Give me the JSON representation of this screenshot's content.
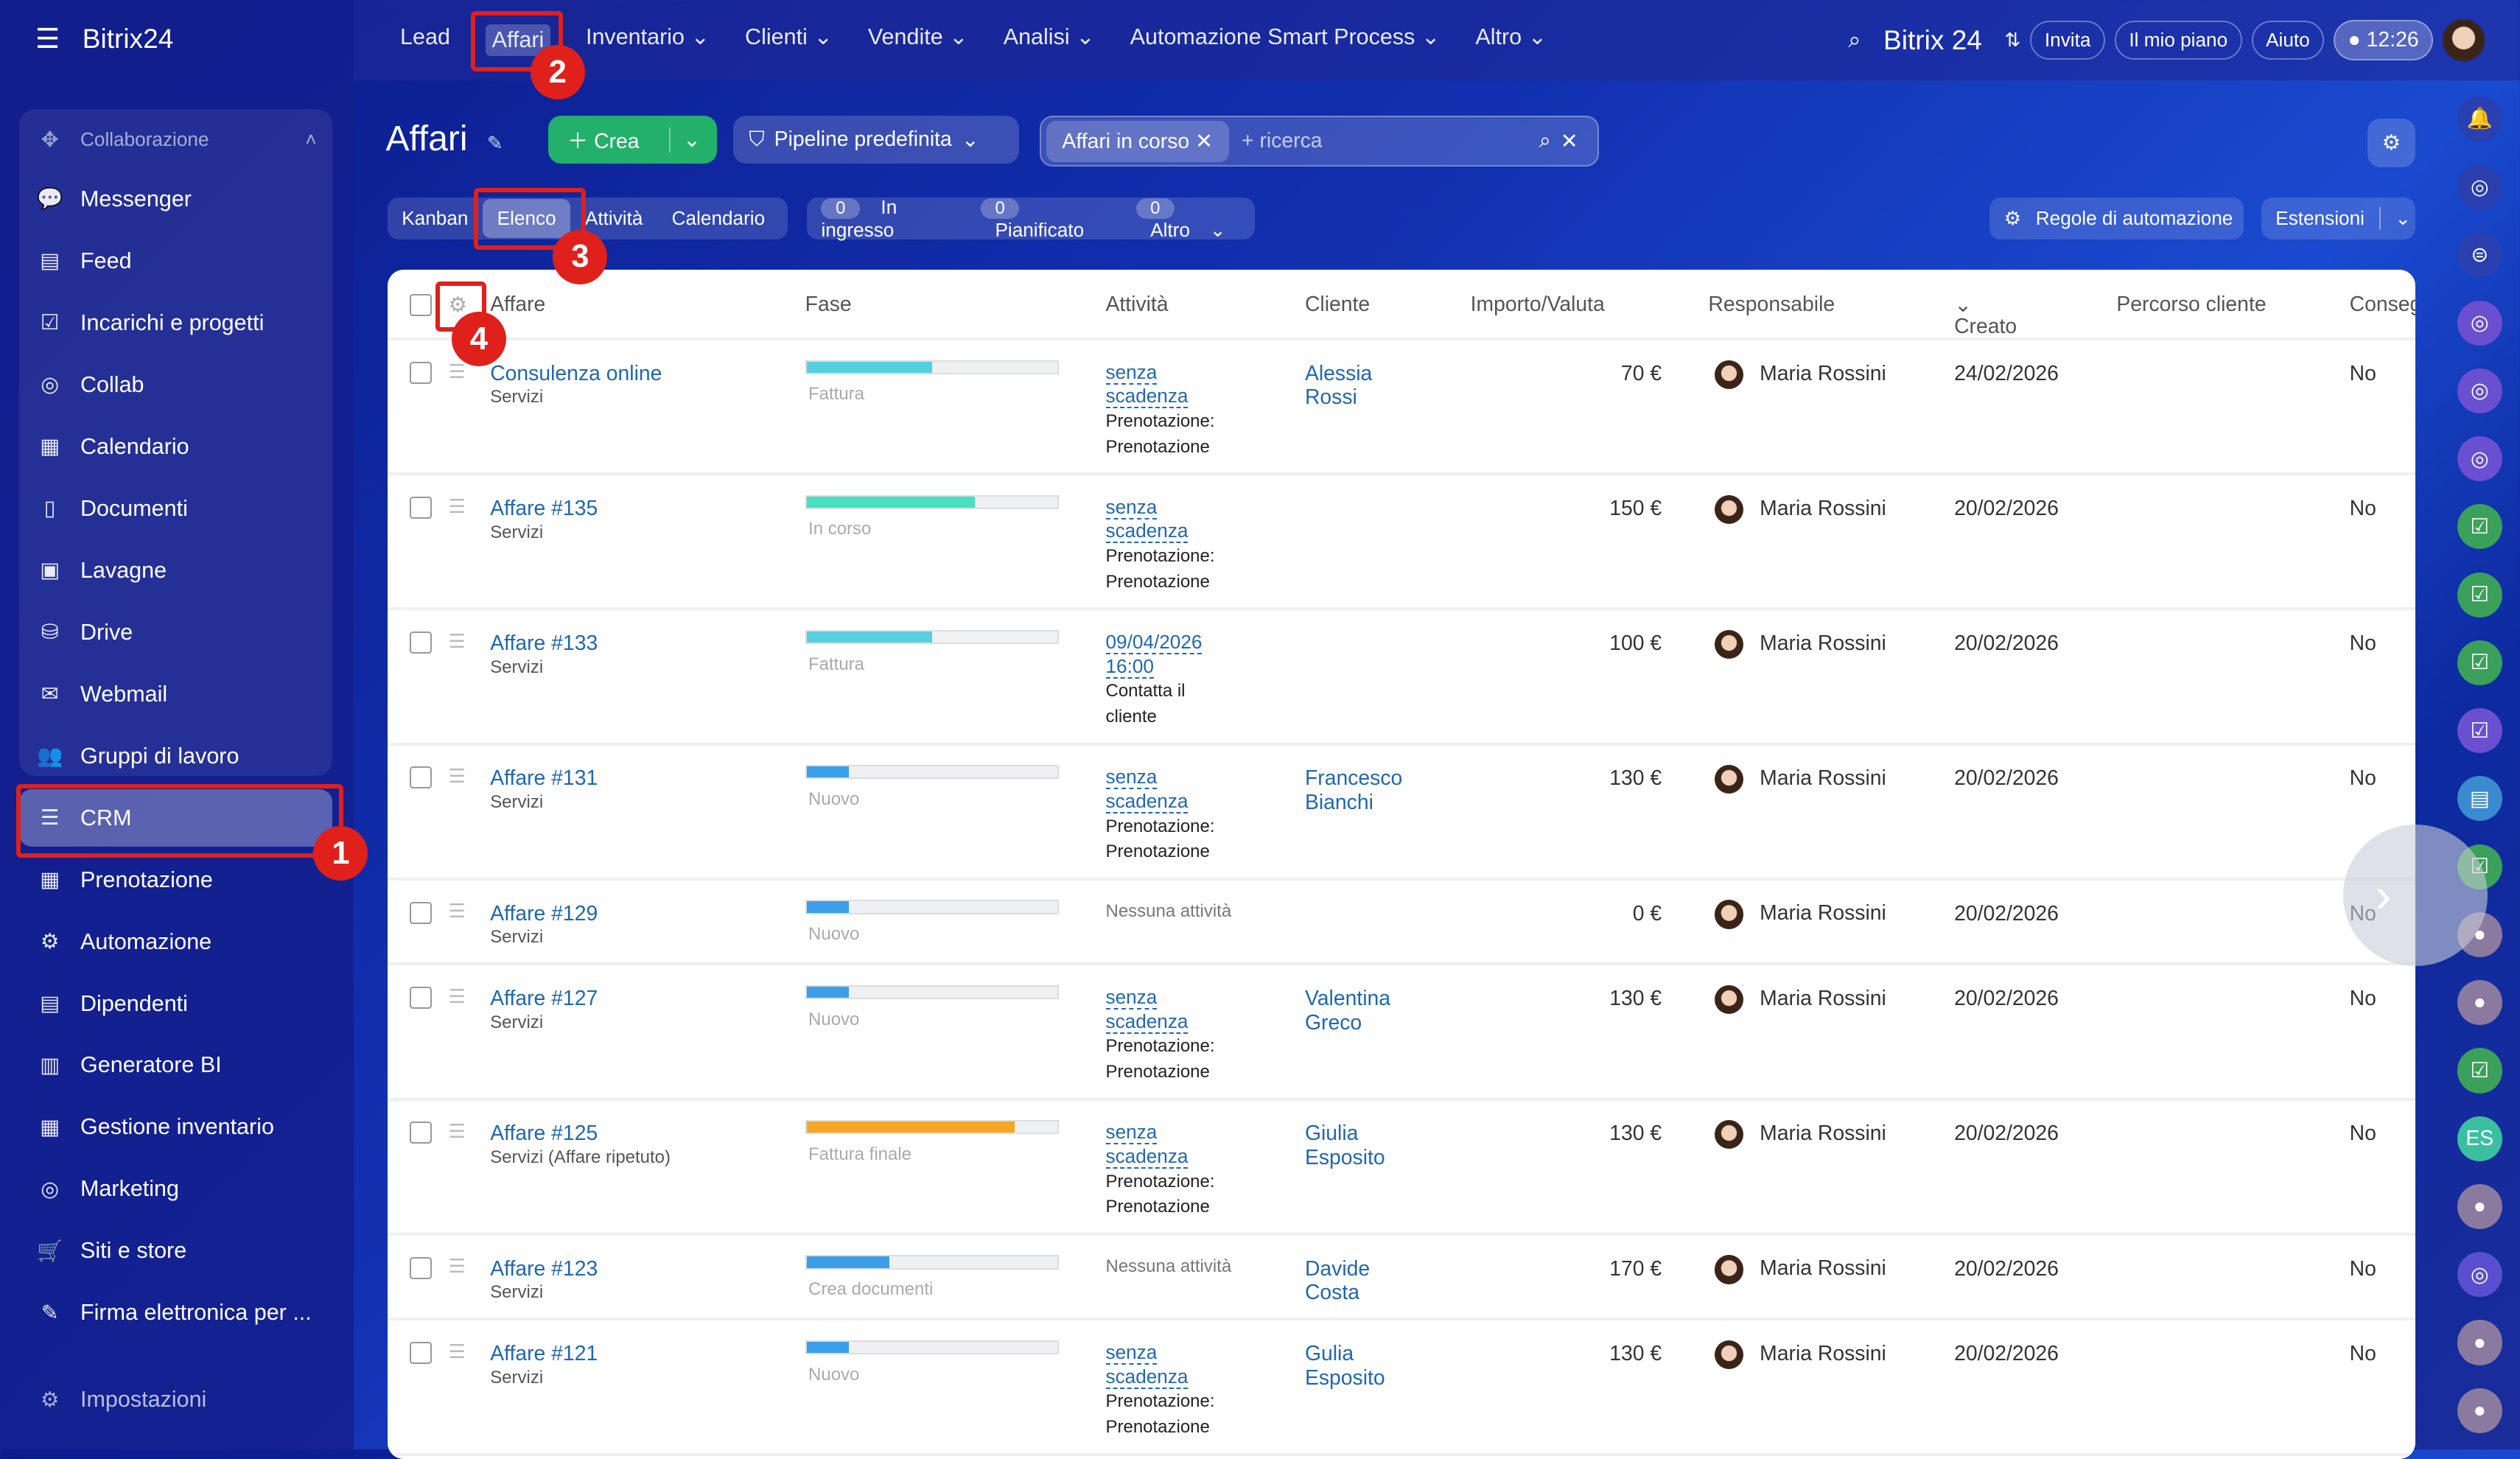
{
  "app": {
    "logo": "Bitrix24",
    "logo_right": "Bitrix 24",
    "time": "12:26"
  },
  "topnav": {
    "items": [
      "Lead",
      "Affari",
      "Inventario",
      "Clienti",
      "Vendite",
      "Analisi",
      "Automazione Smart Process",
      "Altro"
    ],
    "invite": "Invita",
    "plan": "Il mio piano",
    "help": "Aiuto"
  },
  "sidebar": {
    "group": "Collaborazione",
    "items": [
      "Messenger",
      "Feed",
      "Incarichi e progetti",
      "Collab",
      "Calendario",
      "Documenti",
      "Lavagne",
      "Drive",
      "Webmail",
      "Gruppi di lavoro",
      "CRM",
      "Prenotazione",
      "Automazione",
      "Dipendenti",
      "Generatore BI",
      "Gestione inventario",
      "Marketing",
      "Siti e store",
      "Firma elettronica per ..."
    ],
    "settings": "Impostazioni"
  },
  "page": {
    "title": "Affari",
    "create": "Crea",
    "pipeline": "Pipeline predefinita",
    "filter_tag": "Affari in corso",
    "search_placeholder": "+ ricerca"
  },
  "views": {
    "items": [
      "Kanban",
      "Elenco",
      "Attività",
      "Calendario"
    ],
    "counters": [
      {
        "n": "0",
        "label": "In ingresso"
      },
      {
        "n": "0",
        "label": "Pianificato"
      },
      {
        "n": "0",
        "label": "Altro"
      }
    ],
    "automation": "Regole di automazione",
    "extensions": "Estensioni"
  },
  "table": {
    "columns": [
      "Affare",
      "Fase",
      "Attività",
      "Cliente",
      "Importo/Valuta",
      "Responsabile",
      "Creato",
      "Percorso cliente",
      "Conseg"
    ],
    "rows": [
      {
        "name": "Consulenza online",
        "sub": "Servizi",
        "phase": "Fattura",
        "progress": 0.5,
        "color": "#55d0e0",
        "act1": "senza",
        "act2": "scadenza",
        "act3": "Prenotazione:",
        "act4": "Prenotazione",
        "client1": "Alessia",
        "client2": "Rossi",
        "amount": "70 €",
        "resp": "Maria Rossini",
        "created": "24/02/2026",
        "cons": "No"
      },
      {
        "name": "Affare #135",
        "sub": "Servizi",
        "phase": "In corso",
        "progress": 0.67,
        "color": "#47e0c0",
        "act1": "senza",
        "act2": "scadenza",
        "act3": "Prenotazione:",
        "act4": "Prenotazione",
        "client1": "",
        "client2": "",
        "amount": "150 €",
        "resp": "Maria Rossini",
        "created": "20/02/2026",
        "cons": "No"
      },
      {
        "name": "Affare #133",
        "sub": "Servizi",
        "phase": "Fattura",
        "progress": 0.5,
        "color": "#55d0e0",
        "act1": "09/04/2026",
        "act2": "16:00",
        "act3": "Contatta il",
        "act4": "cliente",
        "client1": "",
        "client2": "",
        "amount": "100 €",
        "resp": "Maria Rossini",
        "created": "20/02/2026",
        "cons": "No"
      },
      {
        "name": "Affare #131",
        "sub": "Servizi",
        "phase": "Nuovo",
        "progress": 0.17,
        "color": "#3b9ee8",
        "act1": "senza",
        "act2": "scadenza",
        "act3": "Prenotazione:",
        "act4": "Prenotazione",
        "client1": "Francesco",
        "client2": "Bianchi",
        "amount": "130 €",
        "resp": "Maria Rossini",
        "created": "20/02/2026",
        "cons": "No"
      },
      {
        "name": "Affare #129",
        "sub": "Servizi",
        "phase": "Nuovo",
        "progress": 0.17,
        "color": "#3b9ee8",
        "none": "Nessuna attività",
        "client1": "",
        "client2": "",
        "amount": "0 €",
        "resp": "Maria Rossini",
        "created": "20/02/2026",
        "cons": "No"
      },
      {
        "name": "Affare #127",
        "sub": "Servizi",
        "phase": "Nuovo",
        "progress": 0.17,
        "color": "#3b9ee8",
        "act1": "senza",
        "act2": "scadenza",
        "act3": "Prenotazione:",
        "act4": "Prenotazione",
        "client1": "Valentina",
        "client2": "Greco",
        "amount": "130 €",
        "resp": "Maria Rossini",
        "created": "20/02/2026",
        "cons": "No"
      },
      {
        "name": "Affare #125",
        "sub": "Servizi (Affare ripetuto)",
        "phase": "Fattura finale",
        "progress": 0.83,
        "color": "#f5a623",
        "act1": "senza",
        "act2": "scadenza",
        "act3": "Prenotazione:",
        "act4": "Prenotazione",
        "client1": "Giulia",
        "client2": "Esposito",
        "amount": "130 €",
        "resp": "Maria Rossini",
        "created": "20/02/2026",
        "cons": "No"
      },
      {
        "name": "Affare #123",
        "sub": "Servizi",
        "phase": "Crea documenti",
        "progress": 0.33,
        "color": "#3b9ee8",
        "none": "Nessuna attività",
        "client1": "Davide",
        "client2": "Costa",
        "amount": "170 €",
        "resp": "Maria Rossini",
        "created": "20/02/2026",
        "cons": "No"
      },
      {
        "name": "Affare #121",
        "sub": "Servizi",
        "phase": "Nuovo",
        "progress": 0.17,
        "color": "#3b9ee8",
        "act1": "senza",
        "act2": "scadenza",
        "act3": "Prenotazione:",
        "act4": "Prenotazione",
        "client1": "Gulia",
        "client2": "Esposito",
        "amount": "130 €",
        "resp": "Maria Rossini",
        "created": "20/02/2026",
        "cons": "No"
      }
    ]
  },
  "annotations": [
    "1",
    "2",
    "3",
    "4"
  ],
  "right_bar": {
    "initials": "ES"
  }
}
